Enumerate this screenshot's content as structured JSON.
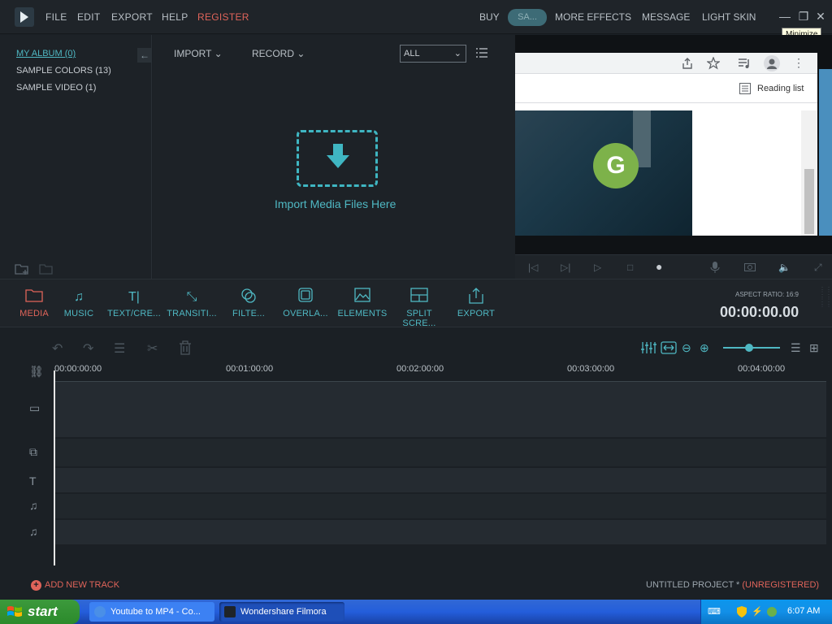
{
  "app": {
    "menu": [
      "FILE",
      "EDIT",
      "EXPORT",
      "HELP",
      "REGISTER"
    ],
    "top_nav": {
      "buy": "BUY",
      "save": "SA...",
      "more_effects": "MORE EFFECTS",
      "message": "MESSAGE",
      "light_skin": "LIGHT SKIN"
    },
    "tooltip": "Minimize"
  },
  "library": {
    "items": [
      "MY ALBUM (0)",
      "SAMPLE COLORS (13)",
      "SAMPLE VIDEO (1)"
    ]
  },
  "media": {
    "import_label": "IMPORT",
    "record_label": "RECORD",
    "filter_value": "ALL",
    "drop_text": "Import Media Files Here"
  },
  "preview": {
    "reading_list": "Reading list",
    "video_logo": "G"
  },
  "toolbar": {
    "tools": [
      {
        "label": "MEDIA",
        "icon": "folder-icon"
      },
      {
        "label": "MUSIC",
        "icon": "music-icon"
      },
      {
        "label": "TEXT/CRE...",
        "icon": "text-icon"
      },
      {
        "label": "TRANSITI...",
        "icon": "transition-icon"
      },
      {
        "label": "FILTE...",
        "icon": "filter-icon"
      },
      {
        "label": "OVERLA...",
        "icon": "overlay-icon"
      },
      {
        "label": "ELEMENTS",
        "icon": "elements-icon"
      },
      {
        "label": "SPLIT SCRE...",
        "icon": "split-screen-icon"
      },
      {
        "label": "EXPORT",
        "icon": "export-icon"
      }
    ],
    "aspect_ratio": "ASPECT RATIO: 16:9",
    "timecode": "00:00:00.00"
  },
  "timeline": {
    "ruler": [
      "00:00:00:00",
      "00:01:00:00",
      "00:02:00:00",
      "00:03:00:00",
      "00:04:00:00"
    ],
    "add_track": "ADD NEW TRACK",
    "project_name": "UNTITLED PROJECT *",
    "project_status": "(UNREGISTERED)"
  },
  "taskbar": {
    "start": "start",
    "tasks": [
      "Youtube to MP4 - Co...",
      "Wondershare Filmora"
    ],
    "clock": "6:07 AM"
  },
  "colors": {
    "accent": "#4fb8c3",
    "highlight": "#e0645a",
    "background": "#1b2025"
  }
}
